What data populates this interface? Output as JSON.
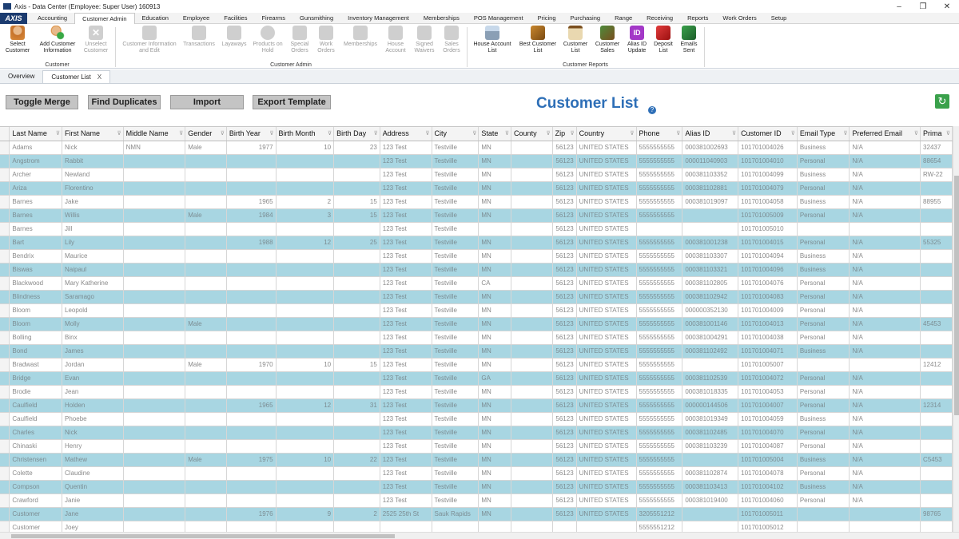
{
  "window": {
    "title": "Axis - Data Center  (Employee: Super User) 160913",
    "min": "–",
    "max": "❐",
    "close": "✕"
  },
  "logo": "AXIS",
  "menu": [
    "Accounting",
    "Customer Admin",
    "Education",
    "Employee",
    "Facilities",
    "Firearms",
    "Gunsmithing",
    "Inventory Management",
    "Memberships",
    "POS Management",
    "Pricing",
    "Purchasing",
    "Range",
    "Receiving",
    "Reports",
    "Work Orders",
    "Setup"
  ],
  "ribbon": {
    "customer_group": {
      "label": "Customer",
      "select": "Select\nCustomer",
      "add": "Add Customer\nInformation",
      "unselect": "Unselect\nCustomer"
    },
    "admin_group": {
      "label": "Customer Admin",
      "info": "Customer Information\nand Edit",
      "transactions": "Transactions",
      "layaways": "Layaways",
      "products_on_hold": "Products on\nHold",
      "special_orders": "Special\nOrders",
      "work_orders": "Work\nOrders",
      "memberships": "Memberships",
      "house_account": "House\nAccount",
      "signed_waivers": "Signed\nWaivers",
      "sales_orders": "Sales\nOrders"
    },
    "reports_group": {
      "label": "Customer Reports",
      "house_account_list": "House Account\nList",
      "best_customer_list": "Best Customer\nList",
      "customer_list": "Customer\nList",
      "customer_sales": "Customer\nSales",
      "alias_id_update": "Alias ID\nUpdate",
      "deposit_list": "Deposit\nList",
      "emails_sent": "Emails\nSent",
      "alias_icon_text": "ID"
    }
  },
  "tabs": {
    "overview": "Overview",
    "customer_list": "Customer List",
    "close": "X"
  },
  "toolbar": {
    "toggle_merge": "Toggle Merge",
    "find_duplicates": "Find Duplicates",
    "import": "Import",
    "export_template": "Export Template"
  },
  "page_title": "Customer List",
  "help": "?",
  "refresh": "↻",
  "grid": {
    "columns": [
      "Last Name",
      "First Name",
      "Middle Name",
      "Gender",
      "Birth Year",
      "Birth Month",
      "Birth Day",
      "Address",
      "City",
      "State",
      "County",
      "Zip",
      "Country",
      "Phone",
      "Alias ID",
      "Customer ID",
      "Email Type",
      "Preferred Email",
      "Prima"
    ],
    "rows": [
      [
        "Adams",
        "Nick",
        "NMN",
        "Male",
        "1977",
        "10",
        "23",
        "123 Test",
        "Testville",
        "MN",
        "",
        "56123",
        "UNITED STATES",
        "5555555555",
        "000381002693",
        "101701004026",
        "Business",
        "N/A",
        "32437"
      ],
      [
        "Angstrom",
        "Rabbit",
        "",
        "",
        "",
        "",
        "",
        "123 Test",
        "Testville",
        "MN",
        "",
        "56123",
        "UNITED STATES",
        "5555555555",
        "000011040903",
        "101701004010",
        "Personal",
        "N/A",
        "88654"
      ],
      [
        "Archer",
        "Newland",
        "",
        "",
        "",
        "",
        "",
        "123 Test",
        "Testville",
        "MN",
        "",
        "56123",
        "UNITED STATES",
        "5555555555",
        "000381103352",
        "101701004099",
        "Business",
        "N/A",
        "RW-22"
      ],
      [
        "Ariza",
        "Florentino",
        "",
        "",
        "",
        "",
        "",
        "123 Test",
        "Testville",
        "MN",
        "",
        "56123",
        "UNITED STATES",
        "5555555555",
        "000381102881",
        "101701004079",
        "Personal",
        "N/A",
        ""
      ],
      [
        "Barnes",
        "Jake",
        "",
        "",
        "1965",
        "2",
        "15",
        "123 Test",
        "Testville",
        "MN",
        "",
        "56123",
        "UNITED STATES",
        "5555555555",
        "000381019097",
        "101701004058",
        "Business",
        "N/A",
        "88955"
      ],
      [
        "Barnes",
        "Willis",
        "",
        "Male",
        "1984",
        "3",
        "15",
        "123 Test",
        "Testville",
        "MN",
        "",
        "56123",
        "UNITED STATES",
        "5555555555",
        "",
        "101701005009",
        "Personal",
        "N/A",
        ""
      ],
      [
        "Barnes",
        "Jill",
        "",
        "",
        "",
        "",
        "",
        "123 Test",
        "Testville",
        "",
        "",
        "56123",
        "UNITED STATES",
        "",
        "",
        "101701005010",
        "",
        "",
        ""
      ],
      [
        "Bart",
        "Lily",
        "",
        "",
        "1988",
        "12",
        "25",
        "123 Test",
        "Testville",
        "MN",
        "",
        "56123",
        "UNITED STATES",
        "5555555555",
        "000381001238",
        "101701004015",
        "Personal",
        "N/A",
        "55325"
      ],
      [
        "Bendrix",
        "Maurice",
        "",
        "",
        "",
        "",
        "",
        "123 Test",
        "Testville",
        "MN",
        "",
        "56123",
        "UNITED STATES",
        "5555555555",
        "000381103307",
        "101701004094",
        "Business",
        "N/A",
        ""
      ],
      [
        "Biswas",
        "Naipaul",
        "",
        "",
        "",
        "",
        "",
        "123 Test",
        "Testville",
        "MN",
        "",
        "56123",
        "UNITED STATES",
        "5555555555",
        "000381103321",
        "101701004096",
        "Business",
        "N/A",
        ""
      ],
      [
        "Blackwood",
        "Mary Katherine",
        "",
        "",
        "",
        "",
        "",
        "123 Test",
        "Testville",
        "CA",
        "",
        "56123",
        "UNITED STATES",
        "5555555555",
        "000381102805",
        "101701004076",
        "Personal",
        "N/A",
        ""
      ],
      [
        "Blindness",
        "Saramago",
        "",
        "",
        "",
        "",
        "",
        "123 Test",
        "Testville",
        "MN",
        "",
        "56123",
        "UNITED STATES",
        "5555555555",
        "000381102942",
        "101701004083",
        "Personal",
        "N/A",
        ""
      ],
      [
        "Bloom",
        "Leopold",
        "",
        "",
        "",
        "",
        "",
        "123 Test",
        "Testville",
        "MN",
        "",
        "56123",
        "UNITED STATES",
        "5555555555",
        "000000352130",
        "101701004009",
        "Personal",
        "N/A",
        ""
      ],
      [
        "Bloom",
        "Molly",
        "",
        "Male",
        "",
        "",
        "",
        "123 Test",
        "Testville",
        "MN",
        "",
        "56123",
        "UNITED STATES",
        "5555555555",
        "000381001146",
        "101701004013",
        "Personal",
        "N/A",
        "45453"
      ],
      [
        "Bolling",
        "Binx",
        "",
        "",
        "",
        "",
        "",
        "123 Test",
        "Testville",
        "MN",
        "",
        "56123",
        "UNITED STATES",
        "5555555555",
        "000381004291",
        "101701004038",
        "Personal",
        "N/A",
        ""
      ],
      [
        "Bond",
        "James",
        "",
        "",
        "",
        "",
        "",
        "123 Test",
        "Testville",
        "MN",
        "",
        "56123",
        "UNITED STATES",
        "5555555555",
        "000381102492",
        "101701004071",
        "Business",
        "N/A",
        ""
      ],
      [
        "Bradwast",
        "Jordan",
        "",
        "Male",
        "1970",
        "10",
        "15",
        "123 Test",
        "Testville",
        "MN",
        "",
        "56123",
        "UNITED STATES",
        "5555555555",
        "",
        "101701005007",
        "",
        "",
        "12412"
      ],
      [
        "Bridge",
        "Evan",
        "",
        "",
        "",
        "",
        "",
        "123 Test",
        "Testville",
        "GA",
        "",
        "56123",
        "UNITED STATES",
        "5555555555",
        "000381102539",
        "101701004072",
        "Personal",
        "N/A",
        ""
      ],
      [
        "Brodie",
        "Jean",
        "",
        "",
        "",
        "",
        "",
        "123 Test",
        "Testville",
        "MN",
        "",
        "56123",
        "UNITED STATES",
        "5555555555",
        "000381018335",
        "101701004053",
        "Personal",
        "N/A",
        ""
      ],
      [
        "Caulfield",
        "Holden",
        "",
        "",
        "1965",
        "12",
        "31",
        "123 Test",
        "Testville",
        "MN",
        "",
        "56123",
        "UNITED STATES",
        "5555555555",
        "000000144506",
        "101701004007",
        "Personal",
        "N/A",
        "12314"
      ],
      [
        "Caulfield",
        "Phoebe",
        "",
        "",
        "",
        "",
        "",
        "123 Test",
        "Testville",
        "MN",
        "",
        "56123",
        "UNITED STATES",
        "5555555555",
        "000381019349",
        "101701004059",
        "Business",
        "N/A",
        ""
      ],
      [
        "Charles",
        "Nick",
        "",
        "",
        "",
        "",
        "",
        "123 Test",
        "Testville",
        "MN",
        "",
        "56123",
        "UNITED STATES",
        "5555555555",
        "000381102485",
        "101701004070",
        "Personal",
        "N/A",
        ""
      ],
      [
        "Chinaski",
        "Henry",
        "",
        "",
        "",
        "",
        "",
        "123 Test",
        "Testville",
        "MN",
        "",
        "56123",
        "UNITED STATES",
        "5555555555",
        "000381103239",
        "101701004087",
        "Personal",
        "N/A",
        ""
      ],
      [
        "Christensen",
        "Mathew",
        "",
        "Male",
        "1975",
        "10",
        "22",
        "123 Test",
        "Testville",
        "MN",
        "",
        "56123",
        "UNITED STATES",
        "5555555555",
        "",
        "101701005004",
        "Business",
        "N/A",
        "C5453"
      ],
      [
        "Colette",
        "Claudine",
        "",
        "",
        "",
        "",
        "",
        "123 Test",
        "Testville",
        "MN",
        "",
        "56123",
        "UNITED STATES",
        "5555555555",
        "000381102874",
        "101701004078",
        "Personal",
        "N/A",
        ""
      ],
      [
        "Compson",
        "Quentin",
        "",
        "",
        "",
        "",
        "",
        "123 Test",
        "Testville",
        "MN",
        "",
        "56123",
        "UNITED STATES",
        "5555555555",
        "000381103413",
        "101701004102",
        "Business",
        "N/A",
        ""
      ],
      [
        "Crawford",
        "Janie",
        "",
        "",
        "",
        "",
        "",
        "123 Test",
        "Testville",
        "MN",
        "",
        "56123",
        "UNITED STATES",
        "5555555555",
        "000381019400",
        "101701004060",
        "Personal",
        "N/A",
        ""
      ],
      [
        "Customer",
        "Jane",
        "",
        "",
        "1976",
        "9",
        "2",
        "2525 25th St",
        "Sauk Rapids",
        "MN",
        "",
        "56123",
        "UNITED STATES",
        "3205551212",
        "",
        "101701005011",
        "",
        "",
        "98765"
      ],
      [
        "Customer",
        "Joey",
        "",
        "",
        "",
        "",
        "",
        "",
        "",
        "",
        "",
        "",
        "",
        "5555551212",
        "",
        "101701005012",
        "",
        "",
        ""
      ]
    ]
  }
}
